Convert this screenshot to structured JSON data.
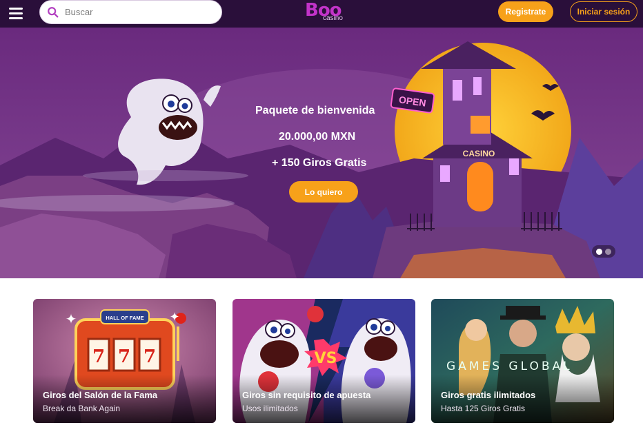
{
  "header": {
    "search_placeholder": "Buscar",
    "logo_text": "Boo",
    "logo_sub": "casino",
    "register_label": "Registrate",
    "login_label": "Iniciar sesión"
  },
  "hero": {
    "line1": "Paquete de bienvenida",
    "line2": "20.000,00 MXN",
    "line3": "+ 150 Giros Gratis",
    "cta_label": "Lo quiero",
    "sign_open": "OPEN",
    "sign_casino": "CASINO",
    "slides_total": 2,
    "slide_active": 1
  },
  "cards": [
    {
      "title": "Giros del Salón de la Fama",
      "subtitle": "Break da Bank Again",
      "badge": "HALL OF FAME",
      "reels": "777"
    },
    {
      "title": "Giros sin requisito de apuesta",
      "subtitle": "Usos ilimitados",
      "badge": "VS"
    },
    {
      "title": "Giros gratis ilimitados",
      "subtitle": "Hasta 125 Giros Gratis",
      "badge": "GAMES GLOBAL"
    }
  ],
  "colors": {
    "header_bg": "#2a0f3a",
    "accent": "#f7a11a",
    "brand": "#c233c9"
  }
}
